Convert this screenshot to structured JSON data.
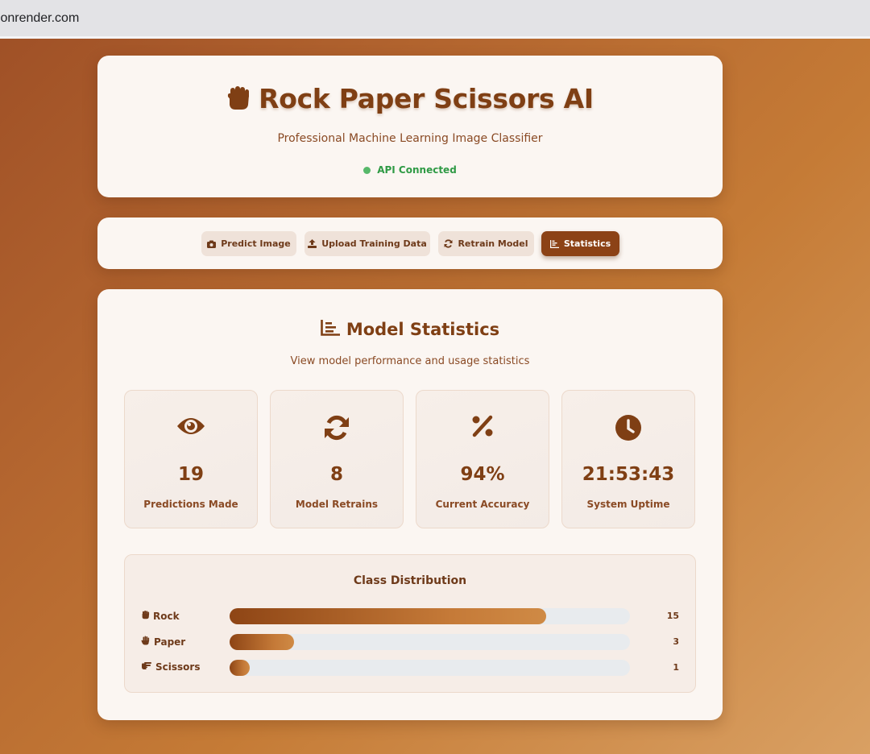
{
  "browser": {
    "url": ".onrender.com"
  },
  "header": {
    "title": "Rock Paper Scissors AI",
    "title_icon": "fist-icon",
    "subtitle": "Professional Machine Learning Image Classifier",
    "status": "API Connected",
    "status_color": "#57b86a"
  },
  "nav": {
    "tabs": [
      {
        "label": "Predict Image",
        "icon": "camera-icon",
        "active": false
      },
      {
        "label": "Upload Training Data",
        "icon": "upload-icon",
        "active": false
      },
      {
        "label": "Retrain Model",
        "icon": "refresh-icon",
        "active": false
      },
      {
        "label": "Statistics",
        "icon": "chart-icon",
        "active": true
      }
    ]
  },
  "stats": {
    "title": "Model Statistics",
    "subtitle": "View model performance and usage statistics",
    "cards": [
      {
        "value": "19",
        "label": "Predictions Made",
        "icon": "eye-icon"
      },
      {
        "value": "8",
        "label": "Model Retrains",
        "icon": "refresh-icon"
      },
      {
        "value": "94%",
        "label": "Current Accuracy",
        "icon": "percent-icon"
      },
      {
        "value": "21:53:43",
        "label": "System Uptime",
        "icon": "clock-icon"
      }
    ]
  },
  "distribution": {
    "title": "Class Distribution",
    "rows": [
      {
        "label": "Rock",
        "icon": "fist-icon",
        "count": "15",
        "fraction": 0.79
      },
      {
        "label": "Paper",
        "icon": "hand-icon",
        "count": "3",
        "fraction": 0.16
      },
      {
        "label": "Scissors",
        "icon": "scissors-hand-icon",
        "count": "1",
        "fraction": 0.05
      }
    ]
  },
  "colors": {
    "primary": "#7f3f14",
    "active_tab": "#8c4216",
    "card_bg": "#fbf6f2"
  }
}
